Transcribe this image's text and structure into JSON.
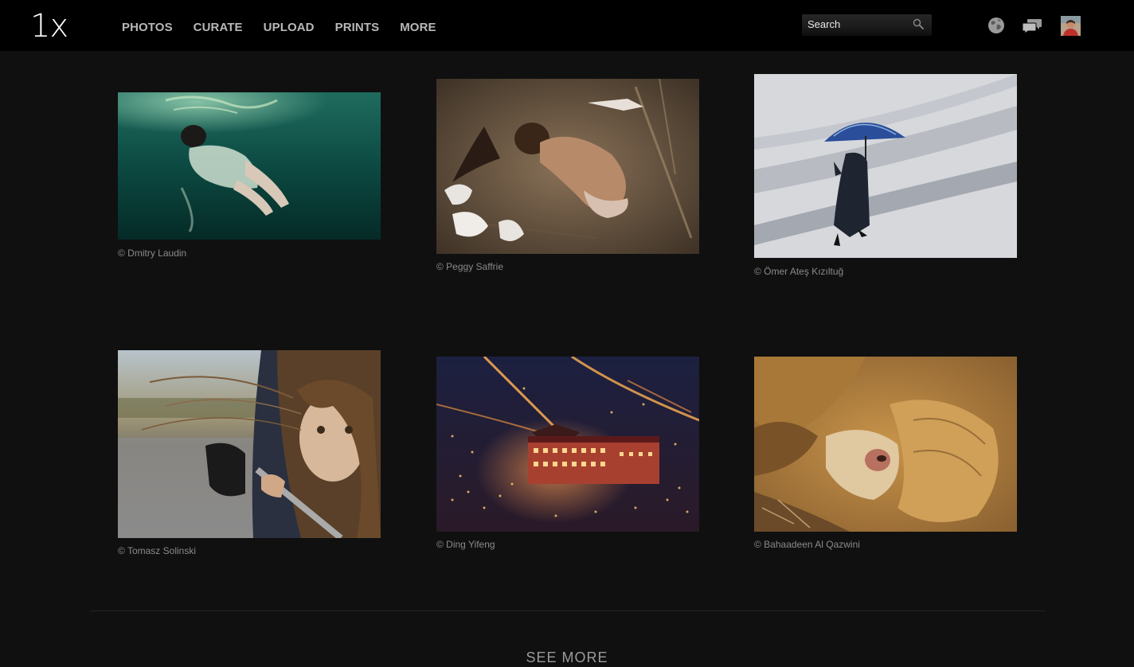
{
  "header": {
    "logo": "1x",
    "nav": [
      "PHOTOS",
      "CURATE",
      "UPLOAD",
      "PRINTS",
      "MORE"
    ],
    "search_placeholder": "Search",
    "icons": [
      "search-icon",
      "globe-icon",
      "chat-icon"
    ]
  },
  "photos": [
    {
      "credit": "© Dmitry Laudin"
    },
    {
      "credit": "© Peggy Saffrie"
    },
    {
      "credit": "© Ömer Ateş Kızıltuğ"
    },
    {
      "credit": "© Tomasz Solinski"
    },
    {
      "credit": "© Ding Yifeng"
    },
    {
      "credit": "© Bahaadeen Al Qazwini"
    }
  ],
  "footer": {
    "see_more": "SEE MORE"
  },
  "colors": {
    "background": "#101010",
    "topbar": "#000000",
    "nav_text": "#b8b8b8",
    "credit_text": "#8a8a8a"
  }
}
